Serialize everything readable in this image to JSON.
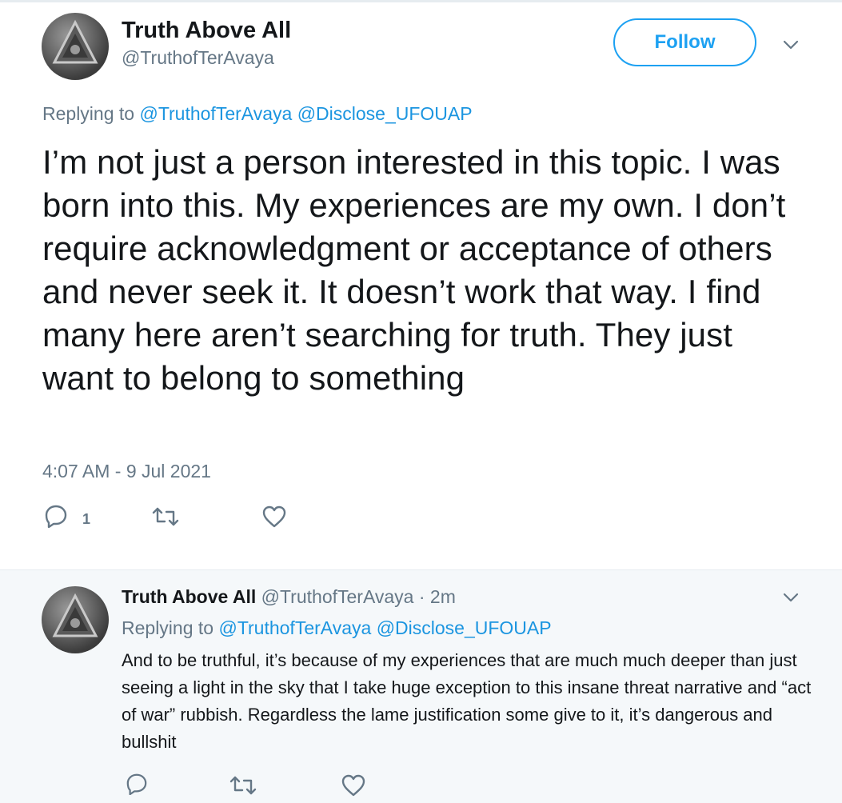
{
  "main_tweet": {
    "author_name": "Truth Above All",
    "author_handle": "@TruthofTerAvaya",
    "follow_label": "Follow",
    "replying_prefix": "Replying to",
    "replying_handles": [
      "@TruthofTerAvaya",
      "@Disclose_UFOUAP"
    ],
    "text": "I’m not just a person interested in this topic. I was born into this. My experiences are my own. I don’t require acknowledgment or acceptance of others and never seek it. It doesn’t work that way. I find many here aren’t searching for truth. They just want to belong to something",
    "timestamp": "4:07 AM - 9 Jul 2021",
    "reply_count": "1"
  },
  "reply_tweet": {
    "author_name": "Truth Above All",
    "author_handle": "@TruthofTerAvaya",
    "separator": "·",
    "time_ago": "2m",
    "replying_prefix": "Replying to",
    "replying_handles": [
      "@TruthofTerAvaya",
      "@Disclose_UFOUAP"
    ],
    "text": "And to be truthful, it’s because of my experiences that are much much deeper than just seeing a light in the sky that I take huge exception to this insane threat narrative and “act of war” rubbish. Regardless the lame justification some give to it, it’s dangerous and bullshit"
  },
  "colors": {
    "accent": "#1da1f2",
    "link": "#1b95e0",
    "secondary_text": "#657786",
    "reply_background": "#f5f8fa"
  },
  "icons": [
    "avatar-icon",
    "chevron-down-icon",
    "reply-icon",
    "retweet-icon",
    "like-icon"
  ]
}
